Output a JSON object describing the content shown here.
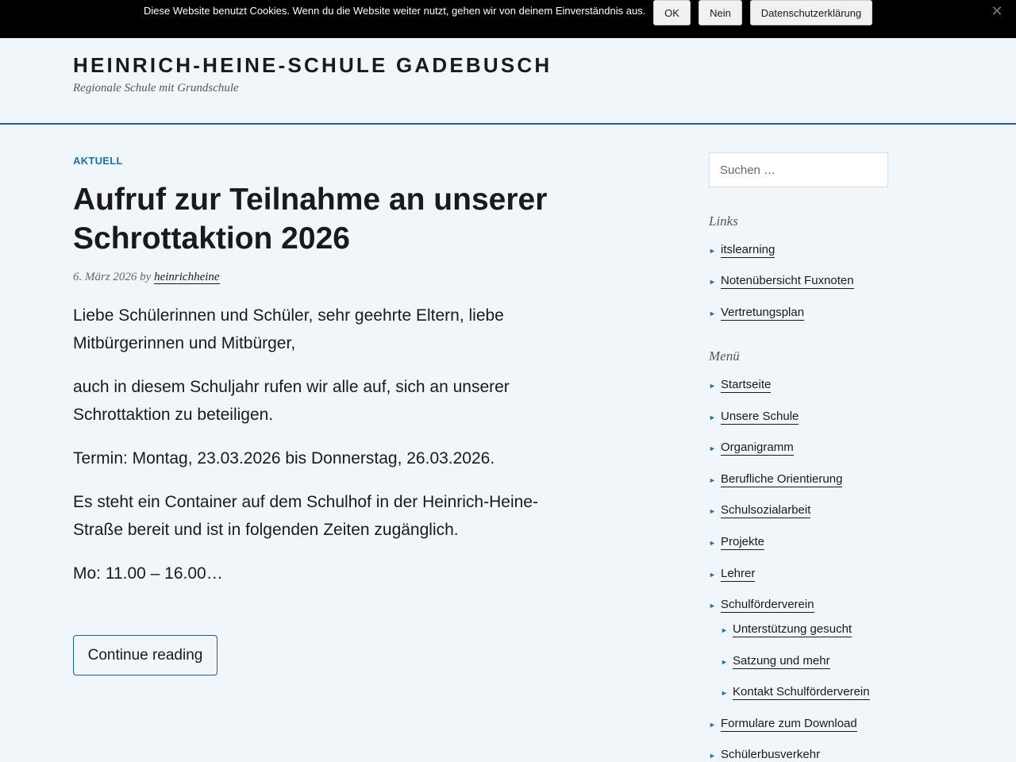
{
  "cookie": {
    "text": "Diese Website benutzt Cookies. Wenn du die Website weiter nutzt, gehen wir von deinem Einverständnis aus.",
    "ok": "OK",
    "nein": "Nein",
    "privacy": "Datenschutzerklärung",
    "close": "✕"
  },
  "header": {
    "title": "HEINRICH-HEINE-SCHULE GADEBUSCH",
    "tagline": "Regionale Schule mit Grundschule"
  },
  "post": {
    "category": "AKTUELL",
    "title": "Aufruf zur Teilnahme an unserer Schrottaktion 2026",
    "date": "6. März 2026",
    "by": "by",
    "author": "heinrichheine",
    "paragraphs": [
      "Liebe Schülerinnen und Schüler, sehr geehrte Eltern, liebe Mitbürgerinnen und Mitbürger,",
      "auch in diesem Schuljahr rufen wir alle auf, sich an unserer Schrottaktion zu beteiligen.",
      "Termin: Montag, 23.03.2026 bis Donnerstag, 26.03.2026.",
      "Es steht ein Container auf dem Schulhof in der Heinrich-Heine-Straße bereit und ist in folgenden Zeiten zugänglich.",
      "Mo: 11.00 – 16.00…"
    ],
    "continue": "Continue reading"
  },
  "sidebar": {
    "search_placeholder": "Suchen …",
    "links_title": "Links",
    "links": [
      "itslearning",
      "Notenübersicht Fuxnoten",
      "Vertretungsplan"
    ],
    "menu_title": "Menü",
    "menu": [
      "Startseite",
      "Unsere Schule",
      "Organigramm",
      "Berufliche Orientierung",
      "Schulsozialarbeit",
      "Projekte",
      "Lehrer",
      "Schulförderverein",
      "Unterstützung gesucht",
      "Satzung und mehr",
      "Kontakt Schulförderverein",
      "Formulare zum Download",
      "Schülerbusverkehr"
    ],
    "arrow": "►",
    "accent_color": "#1d6fb8"
  }
}
